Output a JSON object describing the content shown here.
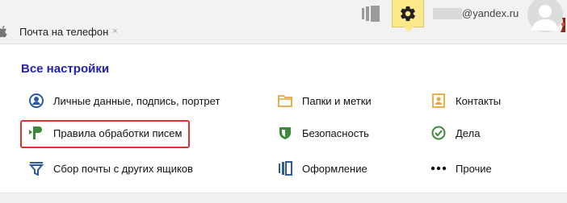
{
  "header": {
    "phone_tab_label": "Почта на телефон",
    "phone_tab_close": "×",
    "user_domain": "@yandex.ru",
    "icons": {
      "apple": "apple-icon",
      "themes": "themes-icon",
      "settings": "gear-icon",
      "avatar": "avatar-icon"
    },
    "settings_active_color": "#fde88a"
  },
  "settings_panel": {
    "title": "Все настройки",
    "title_color": "#2222aa",
    "highlight_color": "#e03131",
    "columns": [
      {
        "items": [
          {
            "label": "Личные данные, подпись, портрет",
            "icon": "person-icon"
          },
          {
            "label": "Правила обработки писем",
            "icon": "flag-rules-icon",
            "highlighted": true
          },
          {
            "label": "Сбор почты с других ящиков",
            "icon": "funnel-icon"
          }
        ]
      },
      {
        "items": [
          {
            "label": "Папки и метки",
            "icon": "folder-icon"
          },
          {
            "label": "Безопасность",
            "icon": "shield-icon"
          },
          {
            "label": "Оформление",
            "icon": "theme-icon"
          }
        ]
      },
      {
        "items": [
          {
            "label": "Контакты",
            "icon": "contacts-icon"
          },
          {
            "label": "Дела",
            "icon": "checkmark-icon"
          },
          {
            "label": "Прочие",
            "icon": "more-dots-icon"
          }
        ]
      }
    ]
  }
}
